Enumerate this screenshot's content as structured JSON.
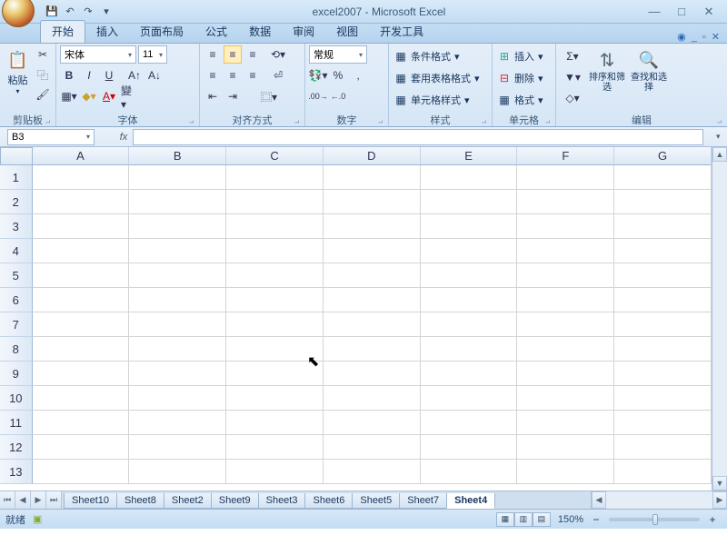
{
  "title": "excel2007 - Microsoft Excel",
  "tabs": {
    "t0": "开始",
    "t1": "插入",
    "t2": "页面布局",
    "t3": "公式",
    "t4": "数据",
    "t5": "审阅",
    "t6": "视图",
    "t7": "开发工具"
  },
  "clipboard": {
    "label": "剪贴板",
    "paste": "粘贴"
  },
  "font": {
    "label": "字体",
    "name": "宋体",
    "size": "11"
  },
  "align": {
    "label": "对齐方式"
  },
  "number": {
    "label": "数字",
    "format": "常规"
  },
  "styles": {
    "label": "样式",
    "cond": "条件格式",
    "table": "套用表格格式",
    "cell": "单元格样式"
  },
  "cells": {
    "label": "单元格",
    "insert": "插入",
    "delete": "删除",
    "format": "格式"
  },
  "edit": {
    "label": "编辑",
    "sort": "排序和筛选",
    "find": "查找和选择"
  },
  "namebox": "B3",
  "cols": [
    "A",
    "B",
    "C",
    "D",
    "E",
    "F",
    "G"
  ],
  "rows": [
    "1",
    "2",
    "3",
    "4",
    "5",
    "6",
    "7",
    "8",
    "9",
    "10",
    "11",
    "12",
    "13"
  ],
  "sheets": [
    "Sheet10",
    "Sheet8",
    "Sheet2",
    "Sheet9",
    "Sheet3",
    "Sheet6",
    "Sheet5",
    "Sheet7",
    "Sheet4"
  ],
  "status": {
    "ready": "就绪",
    "zoom": "150%"
  }
}
